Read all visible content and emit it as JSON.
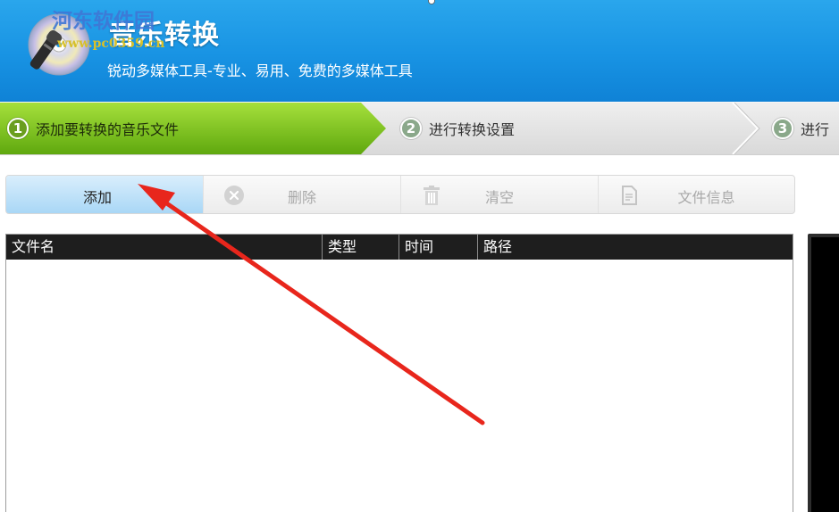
{
  "header": {
    "title": "音乐转换",
    "subtitle": "锐动多媒体工具-专业、易用、免费的多媒体工具",
    "watermark_name": "河东软件园",
    "watermark_url": "www.pc0359.cn"
  },
  "steps": [
    {
      "num": "1",
      "label": "添加要转换的音乐文件",
      "active": true
    },
    {
      "num": "2",
      "label": "进行转换设置",
      "active": false
    },
    {
      "num": "3",
      "label": "进行",
      "active": false
    }
  ],
  "toolbar": {
    "add_label": "添加",
    "delete_label": "删除",
    "clear_label": "清空",
    "info_label": "文件信息"
  },
  "file_list": {
    "columns": [
      "文件名",
      "类型",
      "时间",
      "路径"
    ],
    "rows": []
  },
  "colors": {
    "header_blue": "#1893e3",
    "active_step_green": "#79c21c",
    "annotation_red": "#e8261c"
  },
  "icons": {
    "logo": "cd-microphone-logo",
    "delete": "close-circle-icon",
    "clear": "trash-icon",
    "info": "document-icon"
  }
}
